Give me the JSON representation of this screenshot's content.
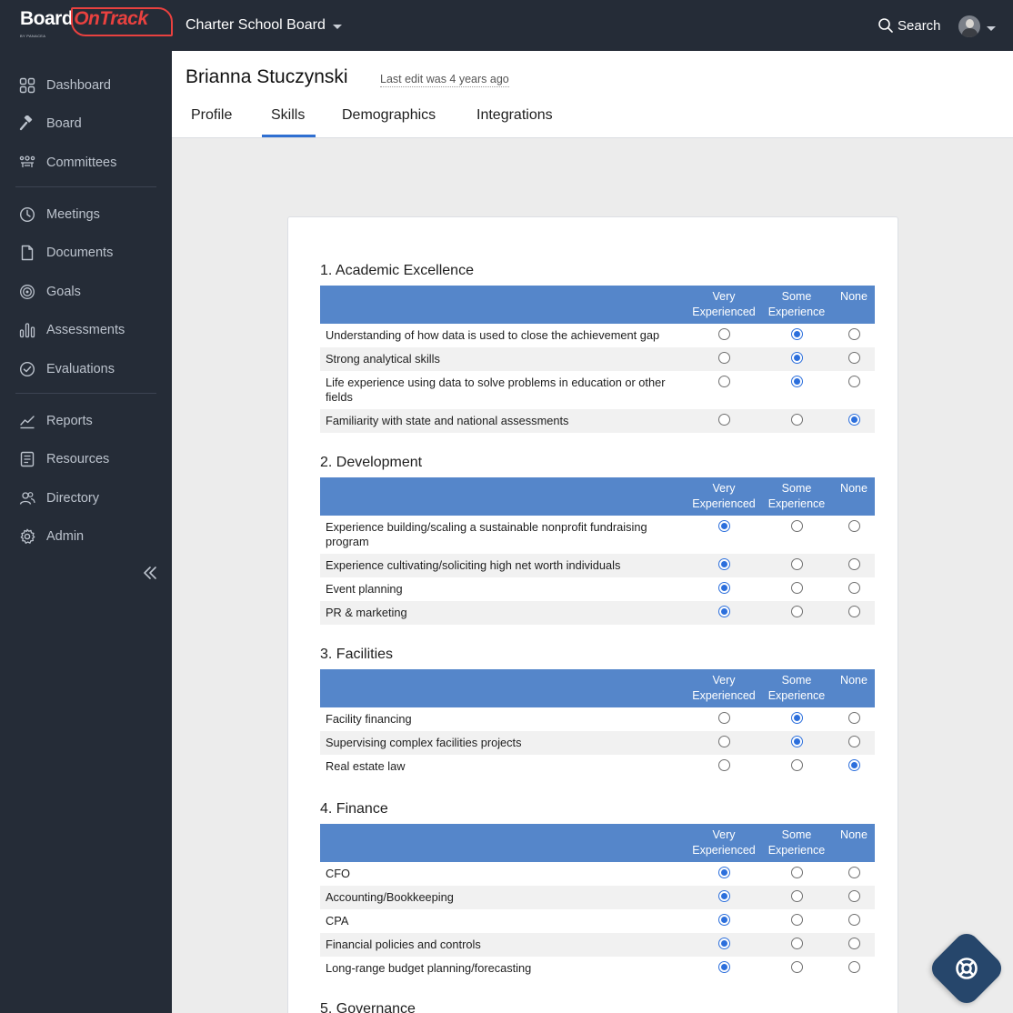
{
  "app": {
    "logo_board": "Board",
    "logo_ontrack": "OnTrack",
    "logo_byline": "BY PANACEA"
  },
  "topbar": {
    "board_name": "Charter School Board",
    "search_label": "Search"
  },
  "sidebar": {
    "items": [
      {
        "label": "Dashboard",
        "icon": "dashboard-icon"
      },
      {
        "label": "Board",
        "icon": "gavel-icon"
      },
      {
        "label": "Committees",
        "icon": "committees-icon"
      },
      {
        "label": "Meetings",
        "icon": "clock-icon"
      },
      {
        "label": "Documents",
        "icon": "document-icon"
      },
      {
        "label": "Goals",
        "icon": "target-icon"
      },
      {
        "label": "Assessments",
        "icon": "bar-chart-icon"
      },
      {
        "label": "Evaluations",
        "icon": "check-circle-icon"
      },
      {
        "label": "Reports",
        "icon": "line-chart-icon"
      },
      {
        "label": "Resources",
        "icon": "list-document-icon"
      },
      {
        "label": "Directory",
        "icon": "people-icon"
      },
      {
        "label": "Admin",
        "icon": "gear-icon"
      }
    ]
  },
  "header": {
    "member_name": "Brianna Stuczynski",
    "last_edit": "Last edit was 4 years ago",
    "tabs": [
      "Profile",
      "Skills",
      "Demographics",
      "Integrations"
    ],
    "active_tab": "Skills"
  },
  "columns": {
    "very_line1": "Very",
    "very_line2": "Experienced",
    "some_line1": "Some",
    "some_line2": "Experience",
    "none": "None"
  },
  "sections": [
    {
      "title": "1. Academic Excellence",
      "rows": [
        {
          "label": "Understanding of how data is used to close the achievement gap",
          "selected": "some"
        },
        {
          "label": "Strong analytical skills",
          "selected": "some"
        },
        {
          "label": "Life experience using data to solve problems in education or other fields",
          "selected": "some"
        },
        {
          "label": "Familiarity with state and national assessments",
          "selected": "none"
        }
      ]
    },
    {
      "title": "2. Development",
      "rows": [
        {
          "label": "Experience building/scaling a sustainable nonprofit fundraising program",
          "selected": "very"
        },
        {
          "label": "Experience cultivating/soliciting high net worth individuals",
          "selected": "very"
        },
        {
          "label": "Event planning",
          "selected": "very"
        },
        {
          "label": "PR & marketing",
          "selected": "very"
        }
      ]
    },
    {
      "title": "3. Facilities",
      "rows": [
        {
          "label": "Facility financing",
          "selected": "some"
        },
        {
          "label": "Supervising complex facilities projects",
          "selected": "some"
        },
        {
          "label": "Real estate law",
          "selected": "none"
        }
      ]
    },
    {
      "title": "4. Finance",
      "rows": [
        {
          "label": "CFO",
          "selected": "very"
        },
        {
          "label": "Accounting/Bookkeeping",
          "selected": "very"
        },
        {
          "label": "CPA",
          "selected": "very"
        },
        {
          "label": "Financial policies and controls",
          "selected": "very"
        },
        {
          "label": "Long-range budget planning/forecasting",
          "selected": "very"
        }
      ]
    }
  ],
  "next_section_title": "5. Governance",
  "colors": {
    "topbar_bg": "#252c37",
    "table_header_bg": "#5586ca",
    "accent": "#2f6fd1",
    "brand_red": "#e9413f",
    "help_button": "#26466b"
  }
}
